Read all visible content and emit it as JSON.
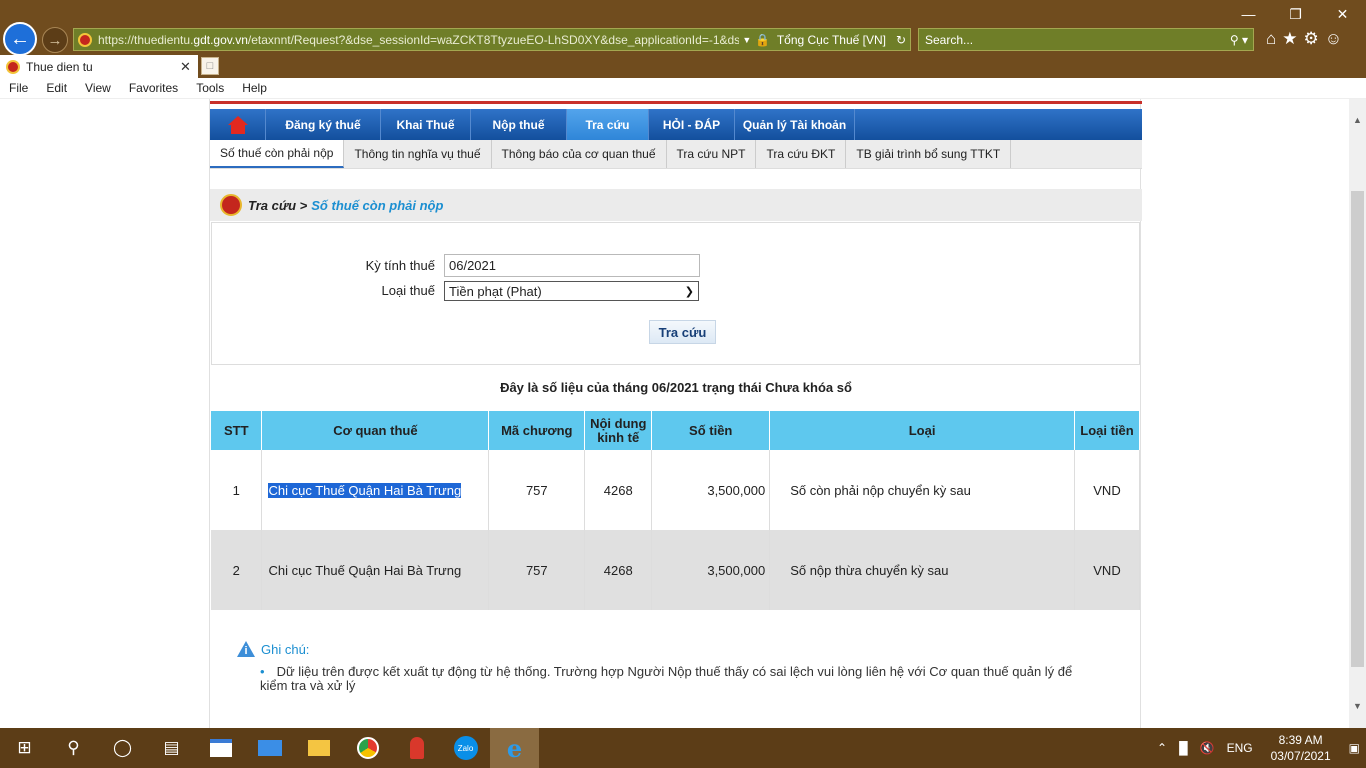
{
  "browser": {
    "url_prefix": "https://thuedientu.",
    "url_domain": "gdt.gov.vn",
    "url_rest": "/etaxnnt/Request?&dse_sessionId=waZCKT8TtyzueEO-LhSD0XY&dse_applicationId=-1&dse",
    "site_identity": "Tổng Cục Thuế [VN]",
    "search_placeholder": "Search...",
    "tab_title": "Thue dien tu"
  },
  "menu": [
    "File",
    "Edit",
    "View",
    "Favorites",
    "Tools",
    "Help"
  ],
  "nav": {
    "items": [
      "Đăng ký thuế",
      "Khai Thuế",
      "Nộp thuế",
      "Tra cứu",
      "HỎI - ĐÁP",
      "Quản lý Tài khoản"
    ],
    "active_index": 3
  },
  "subnav": {
    "items": [
      "Số thuế còn phải nộp",
      "Thông tin nghĩa vụ thuế",
      "Thông báo của cơ quan thuế",
      "Tra cứu NPT",
      "Tra cứu ĐKT",
      "TB giải trình bổ sung TTKT"
    ],
    "active_index": 0
  },
  "breadcrumb": {
    "parent": "Tra cứu >",
    "current": "Số thuế còn phải nộp"
  },
  "form": {
    "period_label": "Kỳ tính thuế",
    "period_value": "06/2021",
    "type_label": "Loại thuế",
    "type_value": "Tiền phạt (Phat)",
    "submit_label": "Tra cứu"
  },
  "notice": "Đây là số liệu của tháng 06/2021 trạng thái Chưa khóa sổ",
  "table": {
    "headers": [
      "STT",
      "Cơ quan thuế",
      "Mã chương",
      "Nội dung kinh tế",
      "Số tiền",
      "Loại",
      "Loại tiền"
    ],
    "rows": [
      [
        "1",
        "Chi cục Thuế Quận Hai Bà Trưng",
        "757",
        "4268",
        "3,500,000",
        "Số còn phải nộp chuyển kỳ sau",
        "VND"
      ],
      [
        "2",
        "Chi cục Thuế Quận Hai Bà Trưng",
        "757",
        "4268",
        "3,500,000",
        "Số nộp thừa chuyển kỳ sau",
        "VND"
      ]
    ]
  },
  "note": {
    "title": "Ghi chú:",
    "text": "Dữ liệu trên được kết xuất tự động từ hệ thống. Trường hợp Người Nộp thuế thấy có sai lệch vui lòng liên hệ với Cơ quan thuế quản lý để kiểm tra và xử lý"
  },
  "taskbar": {
    "lang": "ENG",
    "time": "8:39 AM",
    "date": "03/07/2021",
    "zalo_label": "Zalo"
  }
}
